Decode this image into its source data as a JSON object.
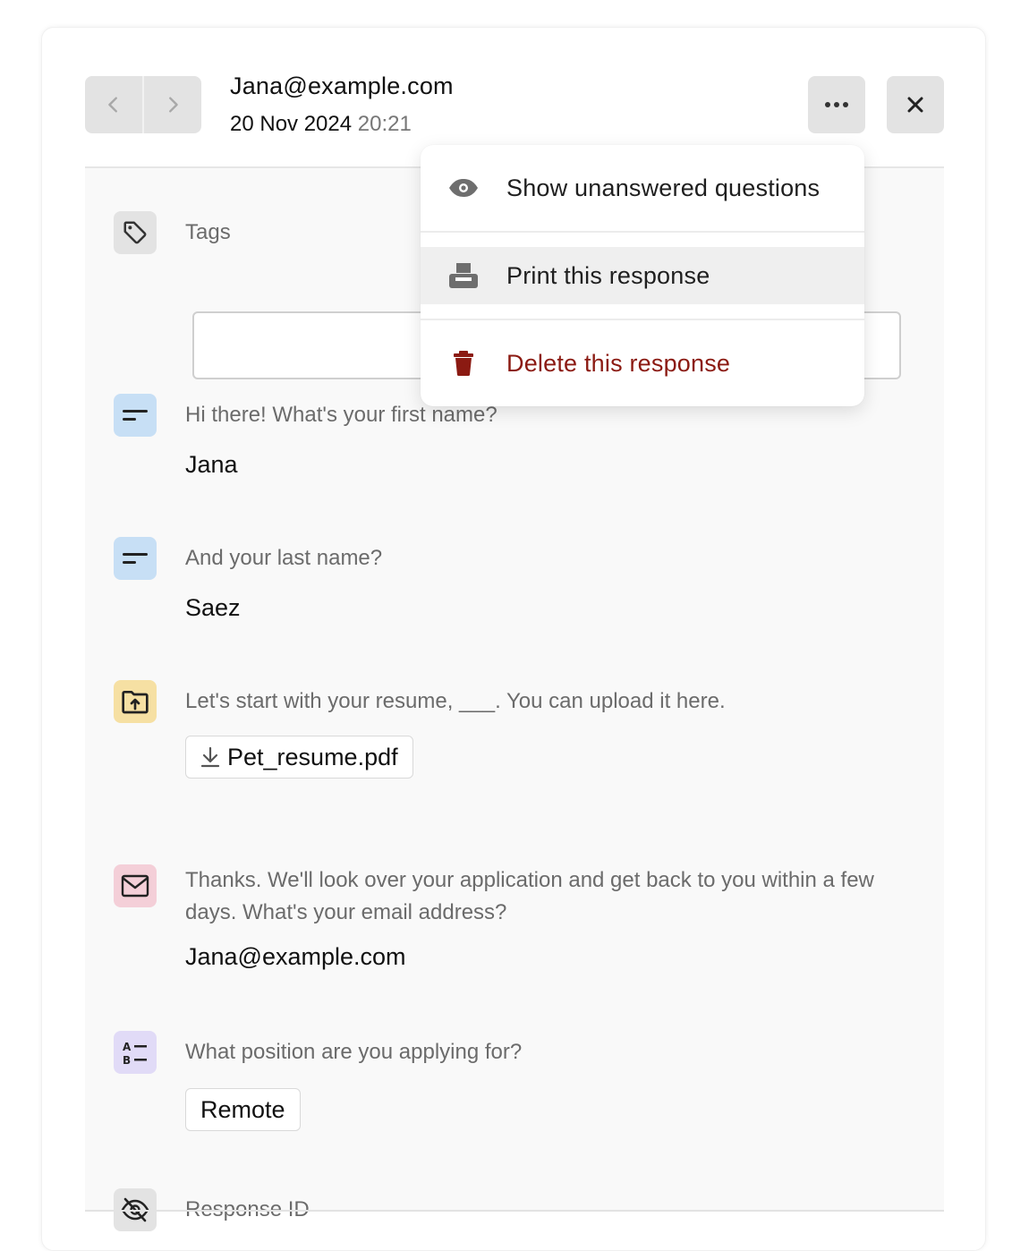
{
  "header": {
    "email": "Jana@example.com",
    "date": "20 Nov 2024",
    "time": "20:21"
  },
  "icons": {
    "prev": "chevron-left-icon",
    "next": "chevron-right-icon",
    "more": "more-horizontal-icon",
    "close": "close-icon"
  },
  "menu": {
    "items": [
      {
        "label": "Show unanswered questions",
        "icon": "eye-icon"
      },
      {
        "label": "Print this response",
        "icon": "printer-icon"
      },
      {
        "label": "Delete this response",
        "icon": "trash-icon",
        "color": "#8b1a12"
      }
    ]
  },
  "tags": {
    "label": "Tags",
    "value": ""
  },
  "questions": [
    {
      "text": "Hi there! What's your first name?",
      "answer": "Jana",
      "icon": "short-text-icon",
      "icon_bg": "#c7dff5"
    },
    {
      "text": "And your last name?",
      "answer": "Saez",
      "icon": "short-text-icon",
      "icon_bg": "#c7dff5"
    },
    {
      "text": "Let's start with your resume, ___. You can upload it here.",
      "answer": "Pet_resume.pdf",
      "icon": "folder-upload-icon",
      "icon_bg": "#f6e0a3"
    },
    {
      "text": "Thanks. We'll look over your application and get back to you within a few days. What's your email address?",
      "answer": "Jana@example.com",
      "icon": "envelope-icon",
      "icon_bg": "#f4cfd8"
    },
    {
      "text": "What position are you applying for?",
      "answer": "Remote",
      "icon": "multiple-choice-icon",
      "icon_bg": "#e1dbf7"
    }
  ],
  "response_id": {
    "label": "Response ID",
    "icon": "eye-off-icon"
  }
}
